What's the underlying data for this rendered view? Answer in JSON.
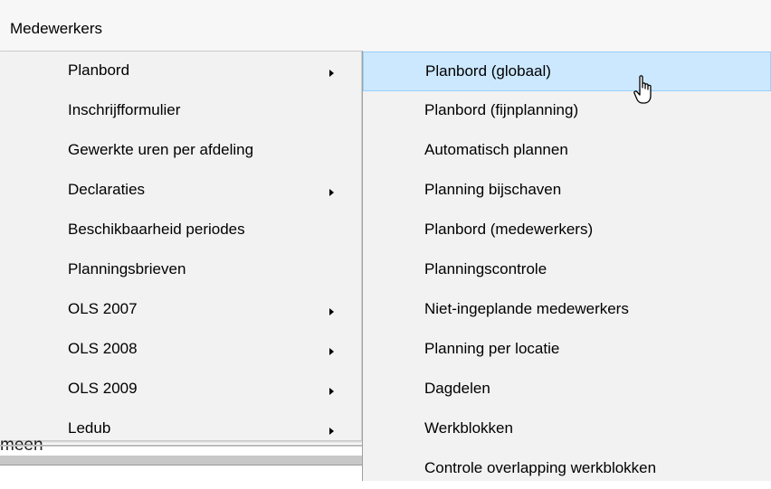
{
  "menubar": {
    "title": "Medewerkers"
  },
  "background": {
    "partial_text": "meen"
  },
  "main_menu": {
    "items": [
      {
        "label": "Planbord",
        "submenu": true
      },
      {
        "label": "Inschrijfformulier",
        "submenu": false
      },
      {
        "label": "Gewerkte uren per afdeling",
        "submenu": false
      },
      {
        "label": "Declaraties",
        "submenu": true
      },
      {
        "label": "Beschikbaarheid periodes",
        "submenu": false
      },
      {
        "label": "Planningsbrieven",
        "submenu": false
      },
      {
        "label": "OLS 2007",
        "submenu": true
      },
      {
        "label": "OLS 2008",
        "submenu": true
      },
      {
        "label": "OLS 2009",
        "submenu": true
      },
      {
        "label": "Ledub",
        "submenu": true
      }
    ]
  },
  "sub_menu": {
    "items": [
      {
        "label": "Planbord (globaal)",
        "highlighted": true
      },
      {
        "label": "Planbord (fijnplanning)"
      },
      {
        "label": "Automatisch plannen"
      },
      {
        "label": "Planning bijschaven"
      },
      {
        "label": "Planbord (medewerkers)"
      },
      {
        "label": "Planningscontrole"
      },
      {
        "label": "Niet-ingeplande medewerkers"
      },
      {
        "label": "Planning per locatie"
      },
      {
        "label": "Dagdelen"
      },
      {
        "label": "Werkblokken"
      },
      {
        "label": "Controle overlapping werkblokken"
      }
    ]
  },
  "colors": {
    "highlight_bg": "#cce8ff",
    "highlight_border": "#99d1ff",
    "menu_bg": "#f2f2f2"
  },
  "cursor": {
    "icon": "hand-pointer-icon"
  }
}
